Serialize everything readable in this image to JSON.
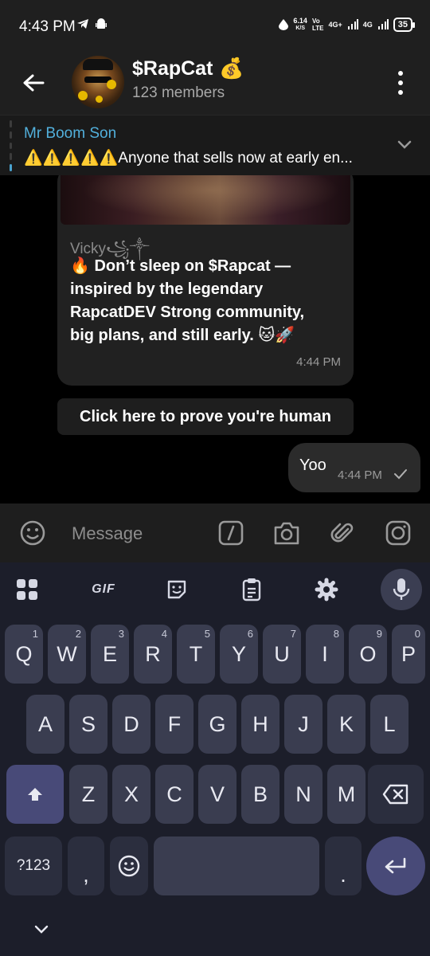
{
  "status_bar": {
    "time": "4:43 PM",
    "net_speed_value": "6.14",
    "net_speed_unit": "K/S",
    "carrier_top": "Vo",
    "carrier_bottom": "LTE",
    "sim1": "4G+",
    "sim2": "4G",
    "battery": "35"
  },
  "header": {
    "title": "$RapCat",
    "title_emoji": "💰",
    "subtitle": "123 members"
  },
  "pinned": {
    "sender": "Mr Boom Son",
    "text": "⚠️⚠️⚠️⚠️⚠️Anyone that sells now at early en..."
  },
  "messages": {
    "incoming": {
      "sender": "Vicky꧁༒",
      "lines": [
        "🔥 Don’t sleep on $Rapcat —",
        "inspired by the legendary",
        "RapcatDEV Strong community,",
        "big plans, and still early. 🐱🚀"
      ],
      "time": "4:44 PM"
    },
    "button_label": "Click here to prove you're human",
    "outgoing": {
      "text": "Yoo",
      "time": "4:44 PM"
    }
  },
  "input": {
    "placeholder": "Message",
    "icons": [
      "emoji-icon",
      "command-icon",
      "camera-icon",
      "attach-icon",
      "instagram-icon"
    ]
  },
  "keyboard": {
    "toolbar": {
      "gif_label": "GIF"
    },
    "row1": [
      {
        "k": "Q",
        "h": "1"
      },
      {
        "k": "W",
        "h": "2"
      },
      {
        "k": "E",
        "h": "3"
      },
      {
        "k": "R",
        "h": "4"
      },
      {
        "k": "T",
        "h": "5"
      },
      {
        "k": "Y",
        "h": "6"
      },
      {
        "k": "U",
        "h": "7"
      },
      {
        "k": "I",
        "h": "8"
      },
      {
        "k": "O",
        "h": "9"
      },
      {
        "k": "P",
        "h": "0"
      }
    ],
    "row2": [
      "A",
      "S",
      "D",
      "F",
      "G",
      "H",
      "J",
      "K",
      "L"
    ],
    "row3": [
      "Z",
      "X",
      "C",
      "V",
      "B",
      "N",
      "M"
    ],
    "symbols_label": "?123",
    "comma_label": ",",
    "period_label": "."
  },
  "colors": {
    "accent_blue": "#52b0dc",
    "keyboard_bg": "#1c1e2a",
    "key_bg": "#3a3d50",
    "shift_bg": "#484a78"
  }
}
